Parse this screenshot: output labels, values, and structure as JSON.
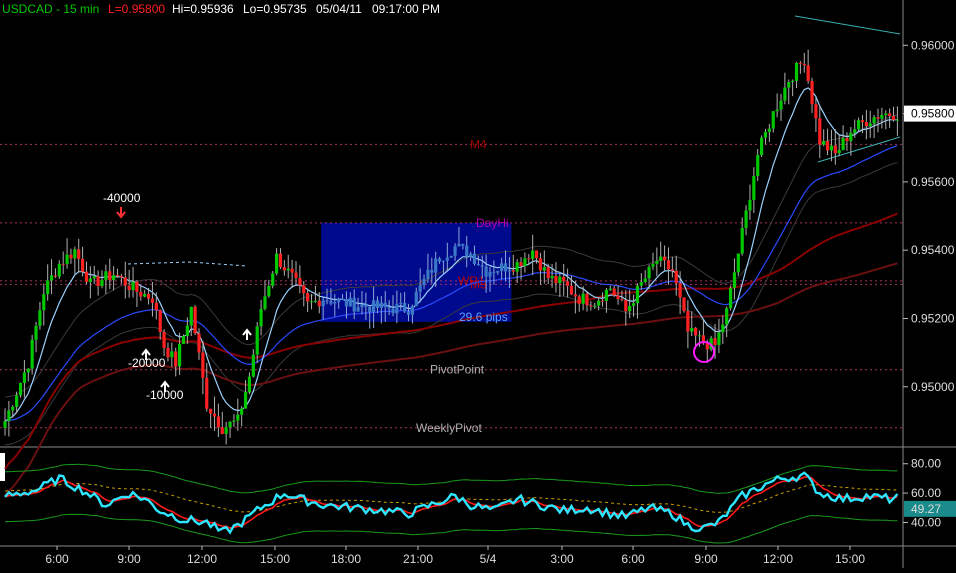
{
  "header": {
    "symbol": "USDCAD - 15 min",
    "last": "L=0.95800",
    "hi": "Hi=0.95936",
    "lo": "Lo=0.95735",
    "date": "05/04/11",
    "time": "09:17:00 PM"
  },
  "colors": {
    "background": "#000000",
    "bull_candle": "#00c800",
    "bear_candle": "#ff2020",
    "highlight_box": "#000a8c",
    "highlight_candle": "#3a78c8",
    "ema_fast": "#9ad2ff",
    "ema_mid": "#2a4aff",
    "sma_slow": "#8a0000",
    "level_line": "#a83264",
    "osc_main": "#2ee6ff",
    "osc_signal": "#ff1a1a",
    "osc_band": "#1a9a1a",
    "circle": "#ff1aff"
  },
  "chart_data": [
    {
      "type": "candlestick",
      "title": "USDCAD - 15 min",
      "ylim": [
        0.9485,
        0.9608
      ],
      "y_ticks": [
        "0.96000",
        "0.95800",
        "0.95600",
        "0.95400",
        "0.95200",
        "0.95000"
      ],
      "x_ticks": [
        "6:00",
        "9:00",
        "12:00",
        "15:00",
        "18:00",
        "21:00",
        "5/4",
        "3:00",
        "6:00",
        "9:00",
        "12:00",
        "15:00"
      ],
      "last_price_label": "0.95800",
      "levels": [
        {
          "name": "M4",
          "value": 0.9571,
          "color": "#a00000"
        },
        {
          "name": "DayHi",
          "value": 0.9548,
          "color": "#b000b0"
        },
        {
          "name": "WR1",
          "value": 0.9531,
          "color": "#c00000"
        },
        {
          "name": "M3",
          "value": 0.953,
          "color": "#c00000"
        },
        {
          "name": "PivotPoint",
          "value": 0.9505,
          "color": "#b0b0b0"
        },
        {
          "name": "WeeklyPivot",
          "value": 0.9488,
          "color": "#b0b0b0"
        }
      ],
      "annotations": [
        {
          "text": "-40000",
          "color": "#ffffff"
        },
        {
          "text": "-20000",
          "color": "#ffffff"
        },
        {
          "text": "-10000",
          "color": "#ffffff"
        },
        {
          "text": "29.6 pips",
          "color": "#5aa0ff"
        }
      ],
      "keypoints": [
        [
          0,
          0.949
        ],
        [
          6,
          0.9507
        ],
        [
          10,
          0.9528
        ],
        [
          14,
          0.9536
        ],
        [
          18,
          0.954
        ],
        [
          22,
          0.953
        ],
        [
          28,
          0.9533
        ],
        [
          34,
          0.9528
        ],
        [
          38,
          0.9526
        ],
        [
          41,
          0.9512
        ],
        [
          44,
          0.9507
        ],
        [
          48,
          0.9523
        ],
        [
          52,
          0.9495
        ],
        [
          56,
          0.9488
        ],
        [
          60,
          0.949
        ],
        [
          63,
          0.9503
        ],
        [
          66,
          0.9523
        ],
        [
          70,
          0.9538
        ],
        [
          74,
          0.9532
        ],
        [
          78,
          0.9524
        ],
        [
          82,
          0.9526
        ],
        [
          90,
          0.9524
        ],
        [
          98,
          0.9523
        ],
        [
          104,
          0.9523
        ],
        [
          108,
          0.9531
        ],
        [
          112,
          0.9538
        ],
        [
          116,
          0.9541
        ],
        [
          120,
          0.9539
        ],
        [
          124,
          0.9534
        ],
        [
          128,
          0.9535
        ],
        [
          132,
          0.9536
        ],
        [
          136,
          0.954
        ],
        [
          140,
          0.9532
        ],
        [
          144,
          0.953
        ],
        [
          148,
          0.9526
        ],
        [
          152,
          0.9525
        ],
        [
          156,
          0.9529
        ],
        [
          160,
          0.9522
        ],
        [
          164,
          0.953
        ],
        [
          168,
          0.9537
        ],
        [
          172,
          0.9534
        ],
        [
          176,
          0.9516
        ],
        [
          180,
          0.9513
        ],
        [
          183,
          0.9512
        ],
        [
          186,
          0.9522
        ],
        [
          190,
          0.9545
        ],
        [
          194,
          0.9568
        ],
        [
          198,
          0.958
        ],
        [
          202,
          0.959
        ],
        [
          206,
          0.9596
        ],
        [
          210,
          0.9572
        ],
        [
          214,
          0.9568
        ],
        [
          218,
          0.9575
        ],
        [
          222,
          0.9578
        ],
        [
          226,
          0.958
        ],
        [
          230,
          0.958
        ]
      ],
      "highlight_range": {
        "from_bar": 82,
        "to_bar": 130,
        "low": 0.9519,
        "high": 0.9548
      }
    },
    {
      "type": "line",
      "title": "",
      "ylim": [
        26,
        88
      ],
      "y_ticks": [
        "80.00",
        "60.00",
        "40.00"
      ],
      "last_value_label": "49.27",
      "series": [
        {
          "values_key": "oscillator",
          "color": "#2ee6ff"
        },
        {
          "values_key": "signal",
          "color": "#ff1a1a"
        },
        {
          "values_key": "bands",
          "color": "#1a9a1a"
        }
      ],
      "keypoints": [
        [
          0,
          58
        ],
        [
          8,
          62
        ],
        [
          14,
          70
        ],
        [
          20,
          62
        ],
        [
          26,
          52
        ],
        [
          32,
          60
        ],
        [
          36,
          56
        ],
        [
          40,
          48
        ],
        [
          46,
          42
        ],
        [
          52,
          40
        ],
        [
          56,
          33
        ],
        [
          60,
          38
        ],
        [
          66,
          50
        ],
        [
          72,
          60
        ],
        [
          76,
          56
        ],
        [
          82,
          52
        ],
        [
          90,
          50
        ],
        [
          98,
          48
        ],
        [
          104,
          46
        ],
        [
          110,
          52
        ],
        [
          116,
          58
        ],
        [
          120,
          52
        ],
        [
          126,
          48
        ],
        [
          132,
          56
        ],
        [
          138,
          52
        ],
        [
          144,
          48
        ],
        [
          150,
          50
        ],
        [
          156,
          46
        ],
        [
          160,
          44
        ],
        [
          166,
          50
        ],
        [
          172,
          46
        ],
        [
          176,
          38
        ],
        [
          180,
          36
        ],
        [
          184,
          40
        ],
        [
          190,
          58
        ],
        [
          196,
          66
        ],
        [
          200,
          70
        ],
        [
          206,
          72
        ],
        [
          210,
          60
        ],
        [
          216,
          56
        ],
        [
          222,
          58
        ],
        [
          228,
          56
        ],
        [
          230,
          57
        ]
      ]
    }
  ]
}
